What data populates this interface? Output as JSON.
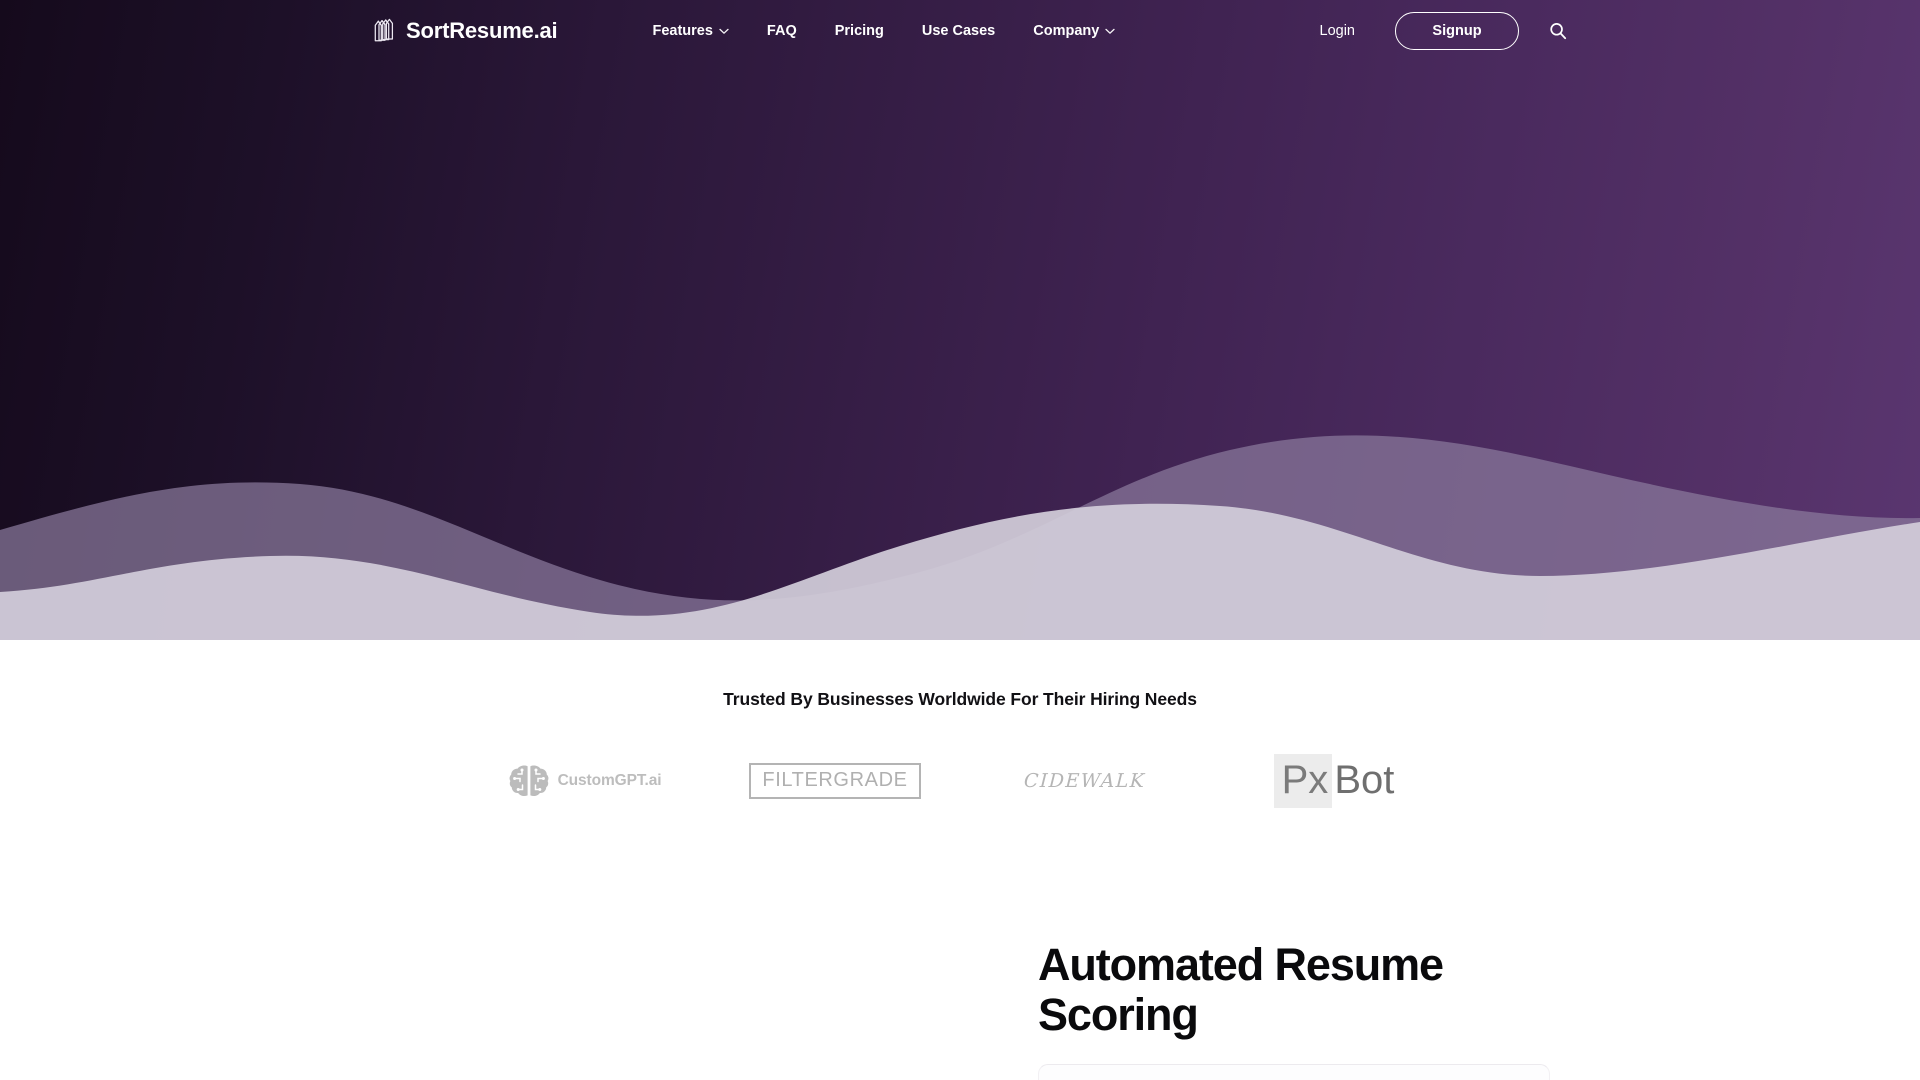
{
  "brand": {
    "name": "SortResume.ai",
    "logo_icon": "stacked-pages-icon"
  },
  "nav": {
    "links": [
      {
        "label": "Features",
        "has_dropdown": true,
        "icon": "chevron-down-icon"
      },
      {
        "label": "FAQ",
        "has_dropdown": false,
        "icon": ""
      },
      {
        "label": "Pricing",
        "has_dropdown": false,
        "icon": ""
      },
      {
        "label": "Use Cases",
        "has_dropdown": false,
        "icon": ""
      },
      {
        "label": "Company",
        "has_dropdown": true,
        "icon": "chevron-down-icon"
      }
    ],
    "login_label": "Login",
    "signup_label": "Signup",
    "search_icon": "search-icon"
  },
  "trusted": {
    "title": "Trusted By Businesses Worldwide For Their Hiring Needs",
    "logos": [
      {
        "name": "CustomGPT.ai",
        "icon": "brain-circuit-icon"
      },
      {
        "name": "FILTERGRADE",
        "icon": ""
      },
      {
        "name": "CIDEWALK",
        "icon": ""
      },
      {
        "name": "PxBot",
        "icon": "",
        "part_highlight": "Px",
        "part_plain": "Bot"
      }
    ]
  },
  "feature": {
    "title_line_1": "Automated Resume",
    "title_line_2": "Scoring"
  },
  "colors": {
    "hero_gradient_start": "#150a1c",
    "hero_gradient_end": "#5a3670",
    "wave_back": "#7d6b8f",
    "wave_front": "#cfc9d6",
    "page_background": "#ffffff",
    "text_dark": "#0a0a0c",
    "logo_gray": "#b5b5b5",
    "nav_text": "#ffffff"
  }
}
